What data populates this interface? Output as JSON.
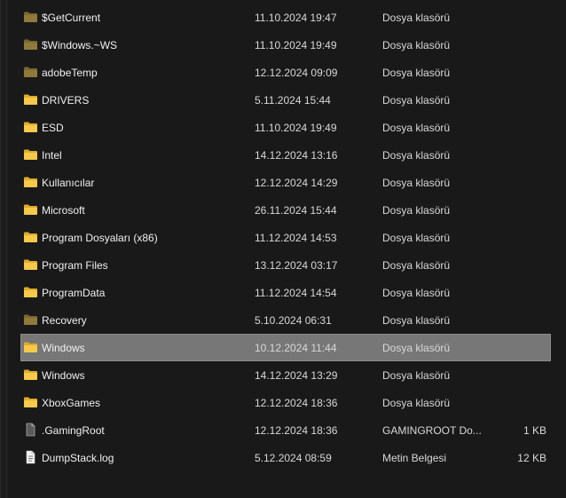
{
  "colors": {
    "background": "#191919",
    "selected_row": "#777777",
    "folder_yellow": "#f6c94a",
    "folder_dim": "#8f7a3a",
    "file_gray": "#cfcfcf"
  },
  "rows": [
    {
      "name": "$GetCurrent",
      "date": "11.10.2024 19:47",
      "type": "Dosya klasörü",
      "size": "",
      "icon": "folder-dim-icon"
    },
    {
      "name": "$Windows.~WS",
      "date": "11.10.2024 19:49",
      "type": "Dosya klasörü",
      "size": "",
      "icon": "folder-dim-icon"
    },
    {
      "name": "adobeTemp",
      "date": "12.12.2024 09:09",
      "type": "Dosya klasörü",
      "size": "",
      "icon": "folder-dim-icon"
    },
    {
      "name": "DRIVERS",
      "date": "5.11.2024 15:44",
      "type": "Dosya klasörü",
      "size": "",
      "icon": "folder-icon"
    },
    {
      "name": "ESD",
      "date": "11.10.2024 19:49",
      "type": "Dosya klasörü",
      "size": "",
      "icon": "folder-icon"
    },
    {
      "name": "Intel",
      "date": "14.12.2024 13:16",
      "type": "Dosya klasörü",
      "size": "",
      "icon": "folder-icon"
    },
    {
      "name": "Kullanıcılar",
      "date": "12.12.2024 14:29",
      "type": "Dosya klasörü",
      "size": "",
      "icon": "folder-icon"
    },
    {
      "name": "Microsoft",
      "date": "26.11.2024 15:44",
      "type": "Dosya klasörü",
      "size": "",
      "icon": "folder-icon"
    },
    {
      "name": "Program Dosyaları (x86)",
      "date": "11.12.2024 14:53",
      "type": "Dosya klasörü",
      "size": "",
      "icon": "folder-icon"
    },
    {
      "name": "Program Files",
      "date": "13.12.2024 03:17",
      "type": "Dosya klasörü",
      "size": "",
      "icon": "folder-icon"
    },
    {
      "name": "ProgramData",
      "date": "11.12.2024 14:54",
      "type": "Dosya klasörü",
      "size": "",
      "icon": "folder-icon"
    },
    {
      "name": "Recovery",
      "date": "5.10.2024 06:31",
      "type": "Dosya klasörü",
      "size": "",
      "icon": "folder-dim-icon"
    },
    {
      "name": "Windows",
      "date": "10.12.2024 11:44",
      "type": "Dosya klasörü",
      "size": "",
      "icon": "folder-icon",
      "selected": true
    },
    {
      "name": "Windows",
      "date": "14.12.2024 13:29",
      "type": "Dosya klasörü",
      "size": "",
      "icon": "folder-icon"
    },
    {
      "name": "XboxGames",
      "date": "12.12.2024 18:36",
      "type": "Dosya klasörü",
      "size": "",
      "icon": "folder-icon"
    },
    {
      "name": ".GamingRoot",
      "date": "12.12.2024 18:36",
      "type": "GAMINGROOT Do...",
      "size": "1 KB",
      "icon": "blank-file-icon"
    },
    {
      "name": "DumpStack.log",
      "date": "5.12.2024 08:59",
      "type": "Metin Belgesi",
      "size": "12 KB",
      "icon": "text-file-icon"
    }
  ]
}
